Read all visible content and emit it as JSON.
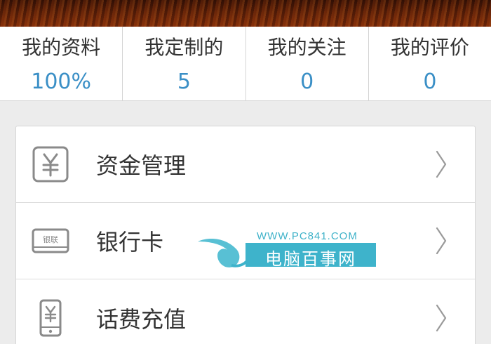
{
  "stats": [
    {
      "label": "我的资料",
      "value": "100%"
    },
    {
      "label": "我定制的",
      "value": "5"
    },
    {
      "label": "我的关注",
      "value": "0"
    },
    {
      "label": "我的评价",
      "value": "0"
    }
  ],
  "menu": [
    {
      "label": "资金管理",
      "icon": "yuan-wallet-icon"
    },
    {
      "label": "银行卡",
      "icon": "bank-card-icon",
      "icon_text": "银联"
    },
    {
      "label": "话费充值",
      "icon": "phone-recharge-icon"
    }
  ],
  "watermark": {
    "url": "WWW.PC841.COM",
    "name": "电脑百事网"
  },
  "colors": {
    "accent": "#3a8fc6",
    "watermark": "#3eb3cb",
    "icon": "#8a8a8a"
  }
}
